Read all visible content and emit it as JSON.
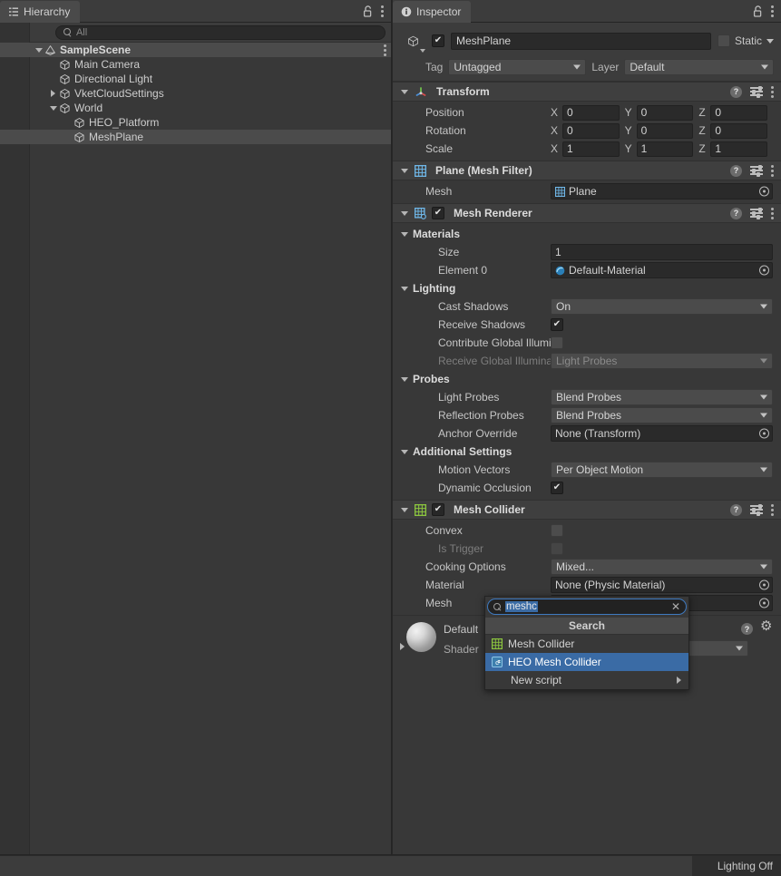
{
  "hierarchy": {
    "tab_label": "Hierarchy",
    "tab_icon": "hierarchy-icon",
    "lock_icon": "lock-icon",
    "menu_icon": "kebab-menu-icon",
    "add_label": "+",
    "search_placeholder": "All",
    "tree": [
      {
        "label": "SampleScene",
        "depth": 0,
        "twisty": "open",
        "icon": "scene-icon",
        "selected": false,
        "kebab": true
      },
      {
        "label": "Main Camera",
        "depth": 1,
        "twisty": "none",
        "icon": "gameobject-icon",
        "selected": false
      },
      {
        "label": "Directional Light",
        "depth": 1,
        "twisty": "none",
        "icon": "gameobject-icon",
        "selected": false
      },
      {
        "label": "VketCloudSettings",
        "depth": 1,
        "twisty": "closed",
        "icon": "gameobject-icon",
        "selected": false
      },
      {
        "label": "World",
        "depth": 1,
        "twisty": "open",
        "icon": "gameobject-icon",
        "selected": false
      },
      {
        "label": "HEO_Platform",
        "depth": 2,
        "twisty": "none",
        "icon": "gameobject-icon",
        "selected": false
      },
      {
        "label": "MeshPlane",
        "depth": 2,
        "twisty": "none",
        "icon": "gameobject-icon",
        "selected": true
      }
    ]
  },
  "inspector": {
    "tab_label": "Inspector",
    "tab_icon": "info-icon",
    "lock_icon": "lock-icon",
    "menu_icon": "kebab-menu-icon",
    "object": {
      "enabled": true,
      "name": "MeshPlane",
      "static_label": "Static",
      "static_checked": false,
      "tag_label": "Tag",
      "tag_value": "Untagged",
      "layer_label": "Layer",
      "layer_value": "Default"
    },
    "transform": {
      "title": "Transform",
      "icon": "transform-axis-icon",
      "rows": [
        {
          "label": "Position",
          "x": "0",
          "y": "0",
          "z": "0"
        },
        {
          "label": "Rotation",
          "x": "0",
          "y": "0",
          "z": "0"
        },
        {
          "label": "Scale",
          "x": "1",
          "y": "1",
          "z": "1"
        }
      ],
      "axis_labels": [
        "X",
        "Y",
        "Z"
      ]
    },
    "mesh_filter": {
      "title": "Plane (Mesh Filter)",
      "icon": "mesh-filter-icon",
      "mesh_label": "Mesh",
      "mesh_value": "Plane"
    },
    "mesh_renderer": {
      "title": "Mesh Renderer",
      "icon": "mesh-renderer-icon",
      "enabled": true,
      "materials_header": "Materials",
      "size_label": "Size",
      "size_value": "1",
      "element0_label": "Element 0",
      "element0_value": "Default-Material",
      "lighting_header": "Lighting",
      "cast_shadows_label": "Cast Shadows",
      "cast_shadows_value": "On",
      "receive_shadows_label": "Receive Shadows",
      "receive_shadows_checked": true,
      "contribute_gi_label": "Contribute Global Illumin",
      "contribute_gi_checked": false,
      "receive_gi_label": "Receive Global Illuminati",
      "receive_gi_value": "Light Probes",
      "probes_header": "Probes",
      "light_probes_label": "Light Probes",
      "light_probes_value": "Blend Probes",
      "reflection_probes_label": "Reflection Probes",
      "reflection_probes_value": "Blend Probes",
      "anchor_override_label": "Anchor Override",
      "anchor_override_value": "None (Transform)",
      "additional_header": "Additional Settings",
      "motion_vectors_label": "Motion Vectors",
      "motion_vectors_value": "Per Object Motion",
      "dynamic_occlusion_label": "Dynamic Occlusion",
      "dynamic_occlusion_checked": true
    },
    "mesh_collider": {
      "title": "Mesh Collider",
      "icon": "mesh-collider-icon",
      "enabled": true,
      "convex_label": "Convex",
      "convex_checked": false,
      "is_trigger_label": "Is Trigger",
      "is_trigger_checked": false,
      "cooking_options_label": "Cooking Options",
      "cooking_options_value": "Mixed...",
      "material_label": "Material",
      "material_value": "None (Physic Material)",
      "mesh_label": "Mesh"
    },
    "material_preview": {
      "title": "Default",
      "shader_label": "Shader",
      "help_icon": "help-icon",
      "gear_icon": "gear-icon"
    }
  },
  "component_search_popup": {
    "search_icon": "search-icon",
    "query": "meshc",
    "clear_icon": "close-icon",
    "title": "Search",
    "items": [
      {
        "label": "Mesh Collider",
        "icon": "mesh-collider-icon",
        "selected": false,
        "submenu": false
      },
      {
        "label": "HEO Mesh Collider",
        "icon": "csharp-script-icon",
        "selected": true,
        "submenu": false
      },
      {
        "label": "New script",
        "icon": "none",
        "selected": false,
        "submenu": true
      }
    ]
  },
  "status_bar": {
    "lighting_label": "Lighting Off"
  },
  "colors": {
    "selection_blue": "#3a6ba5",
    "panel_bg": "#383838",
    "header_bg": "#3f3f3f",
    "field_bg": "#2a2a2a",
    "dropdown_bg": "#4b4b4b",
    "mesh_collider_green": "#8cc63f",
    "mesh_filter_blue": "#6fb7e8"
  }
}
